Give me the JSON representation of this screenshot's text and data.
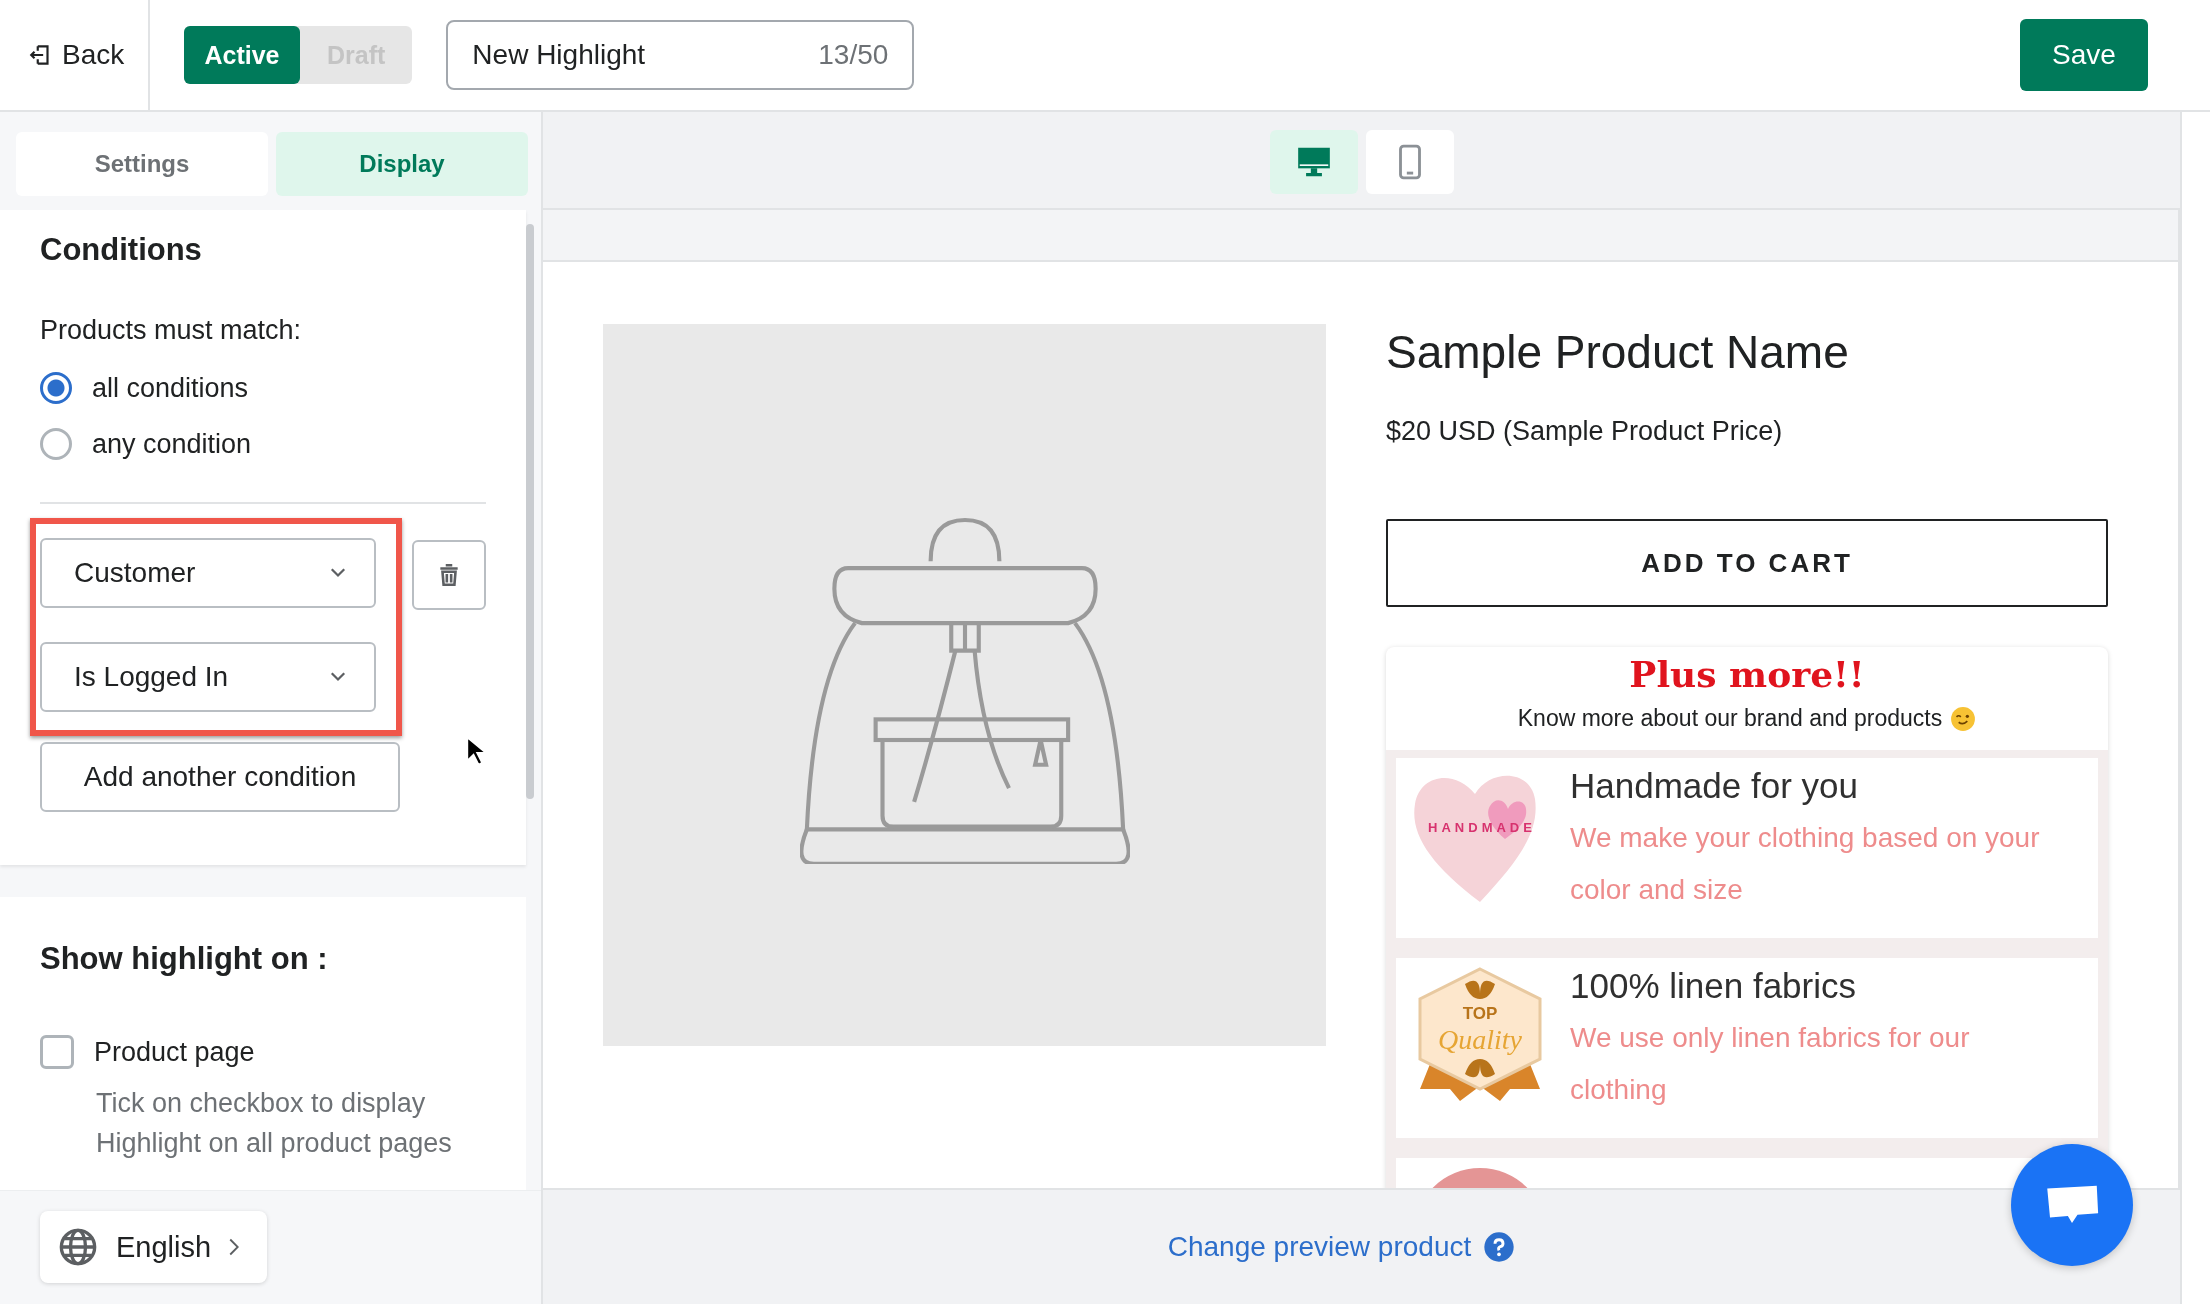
{
  "top_bar": {
    "back": "Back",
    "status_toggle": [
      {
        "label": "Active",
        "selected": true
      },
      {
        "label": "Draft",
        "selected": false
      }
    ],
    "title_field": {
      "value": "New Highlight",
      "counter": "13/50"
    },
    "save": "Save"
  },
  "tabs": [
    {
      "label": "Settings",
      "selected": false
    },
    {
      "label": "Display",
      "selected": true
    }
  ],
  "conditions": {
    "title": "Conditions",
    "match_label": "Products must match:",
    "match_options": [
      {
        "label": "all conditions",
        "selected": true
      },
      {
        "label": "any condition",
        "selected": false
      }
    ],
    "rule": {
      "selects": [
        "Customer",
        "Is Logged In"
      ]
    },
    "add_button": "Add another condition"
  },
  "show_on": {
    "title": "Show highlight on :",
    "options": [
      {
        "label": "Product page",
        "checked": false,
        "hint": "Tick on checkbox to display Highlight on all product pages"
      }
    ]
  },
  "language": "English",
  "devices": [
    {
      "kind": "desktop",
      "selected": true
    },
    {
      "kind": "mobile",
      "selected": false
    }
  ],
  "preview": {
    "product_name": "Sample Product Name",
    "price": "$20 USD (Sample Product Price)",
    "add_to_cart": "ADD TO CART",
    "highlights": {
      "title": "Plus more!!",
      "subtitle": "Know more about our brand and products",
      "items": [
        {
          "kind": "heart",
          "image_text": [
            "HANDMADE"
          ],
          "title": "Handmade for you",
          "text": "We make your clothing based on your color and size"
        },
        {
          "kind": "badge",
          "image_text": [
            "TOP",
            "Quality"
          ],
          "title": "100% linen fabrics",
          "text": "We use only linen fabrics for our clothing"
        },
        {
          "kind": "circle"
        }
      ]
    }
  },
  "change_preview": "Change preview product"
}
